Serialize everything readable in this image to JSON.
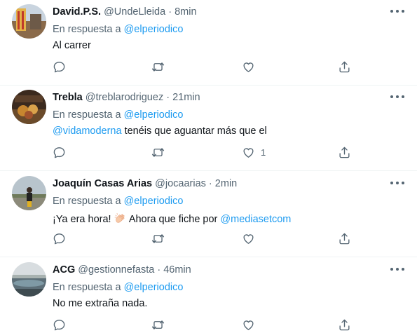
{
  "tweets": [
    {
      "name": "David.P.S.",
      "handle": "@UndeLleida",
      "dot": "·",
      "time": "8min",
      "reply_prefix": "En respuesta a",
      "reply_to": "@elperiodico",
      "text_mention": "",
      "text": "Al carrer",
      "text_link": "",
      "likes": ""
    },
    {
      "name": "Trebla",
      "handle": "@treblarodriguez",
      "dot": "·",
      "time": "21min",
      "reply_prefix": "En respuesta a",
      "reply_to": "@elperiodico",
      "text_mention": "@vidamoderna",
      "text": " tenéis que aguantar más que el",
      "text_link": "",
      "likes": "1"
    },
    {
      "name": "Joaquín Casas Arias",
      "handle": "@jocaarias",
      "dot": "·",
      "time": "2min",
      "reply_prefix": "En respuesta a",
      "reply_to": "@elperiodico",
      "text_mention": "",
      "text": "¡Ya era hora! ",
      "text_after_emoji": " Ahora que fiche por ",
      "text_link": "@mediasetcom",
      "likes": ""
    },
    {
      "name": "ACG",
      "handle": "@gestionnefasta",
      "dot": "·",
      "time": "46min",
      "reply_prefix": "En respuesta a",
      "reply_to": "@elperiodico",
      "text_mention": "",
      "text": "No me extraña nada.",
      "text_link": "",
      "likes": ""
    }
  ],
  "icons": {
    "reply": "reply-icon",
    "retweet": "retweet-icon",
    "like": "heart-icon",
    "share": "share-icon",
    "more": "more-options-icon",
    "emoji": "clapping-hands-emoji"
  },
  "colors": {
    "link": "#1d9bf0",
    "secondary_text": "#536471",
    "primary_text": "#0f1419",
    "divider": "#eff3f4"
  }
}
